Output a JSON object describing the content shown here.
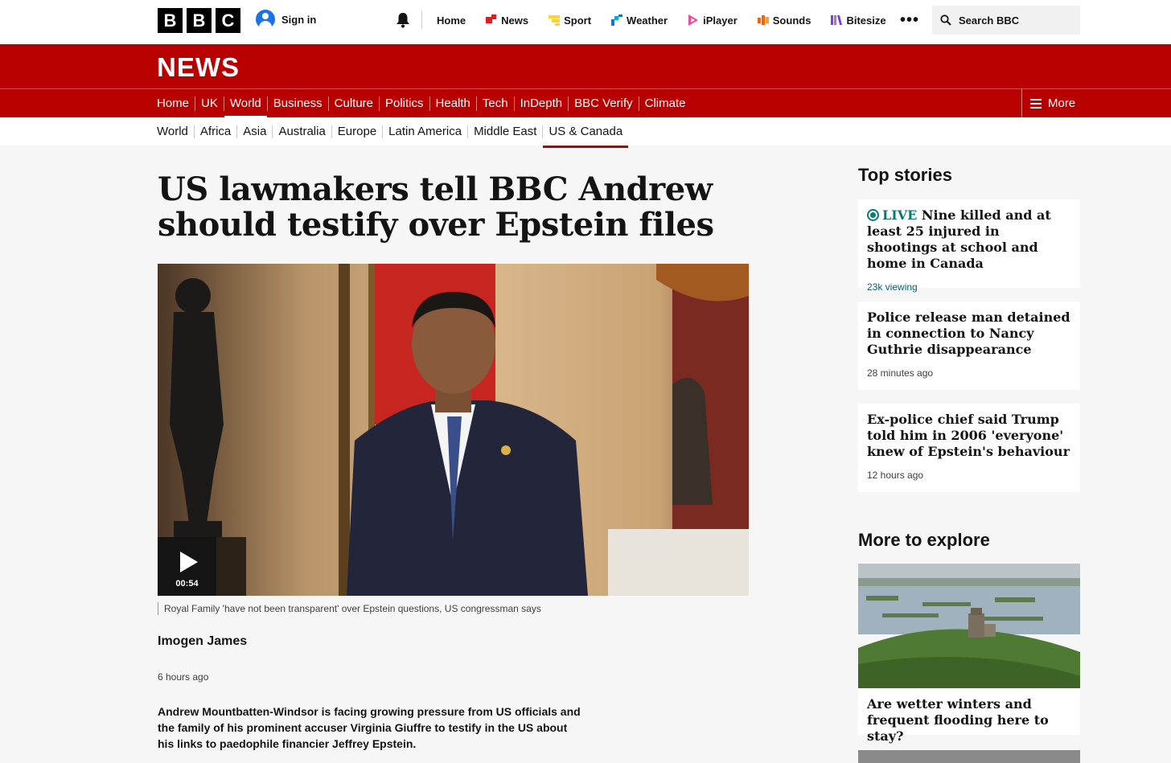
{
  "global": {
    "logo_letters": [
      "B",
      "B",
      "C"
    ],
    "sign_in": "Sign in",
    "nav": [
      {
        "label": "Home",
        "color": ""
      },
      {
        "label": "News",
        "color": "#e51a1a"
      },
      {
        "label": "Sport",
        "color": "#ffd230"
      },
      {
        "label": "Weather",
        "color": "#0c7bc2"
      },
      {
        "label": "iPlayer",
        "color": "#f54997"
      },
      {
        "label": "Sounds",
        "color": "#fa6400"
      },
      {
        "label": "Bitesize",
        "color": "#7f3fd4"
      }
    ],
    "more_dots": "•••",
    "search_placeholder": "Search BBC"
  },
  "news_header": {
    "title": "NEWS",
    "nav": [
      "Home",
      "UK",
      "World",
      "Business",
      "Culture",
      "Politics",
      "Health",
      "Tech",
      "InDepth",
      "BBC Verify",
      "Climate"
    ],
    "active": "World",
    "more_label": "More"
  },
  "subnav": {
    "items": [
      "World",
      "Africa",
      "Asia",
      "Australia",
      "Europe",
      "Latin America",
      "Middle East",
      "US & Canada"
    ],
    "active": "US & Canada"
  },
  "article": {
    "headline": "US lawmakers tell BBC Andrew should testify over Epstein files",
    "video_duration": "00:54",
    "caption": "Royal Family 'have not been transparent' over Epstein questions, US congressman says",
    "byline": "Imogen James",
    "timestamp": "6 hours ago",
    "lead": "Andrew Mountbatten-Windsor is facing growing pressure from US officials and the family of his prominent accuser Virginia Giuffre to testify in the US about his links to paedophile financier Jeffrey Epstein."
  },
  "sidebar": {
    "top_stories_heading": "Top stories",
    "stories": [
      {
        "live_label": "LIVE",
        "title": "Nine killed and at least 25 injured in shootings at school and home in Canada",
        "meta": "23k viewing"
      },
      {
        "live_label": "",
        "title": "Police release man detained in connection to Nancy Guthrie disappearance",
        "meta": "28 minutes ago"
      },
      {
        "live_label": "",
        "title": "Ex-police chief said Trump told him in 2006 'everyone' knew of Epstein's behaviour",
        "meta": "12 hours ago"
      }
    ],
    "explore_heading": "More to explore",
    "explore_title": "Are wetter winters and frequent flooding here to stay?"
  }
}
